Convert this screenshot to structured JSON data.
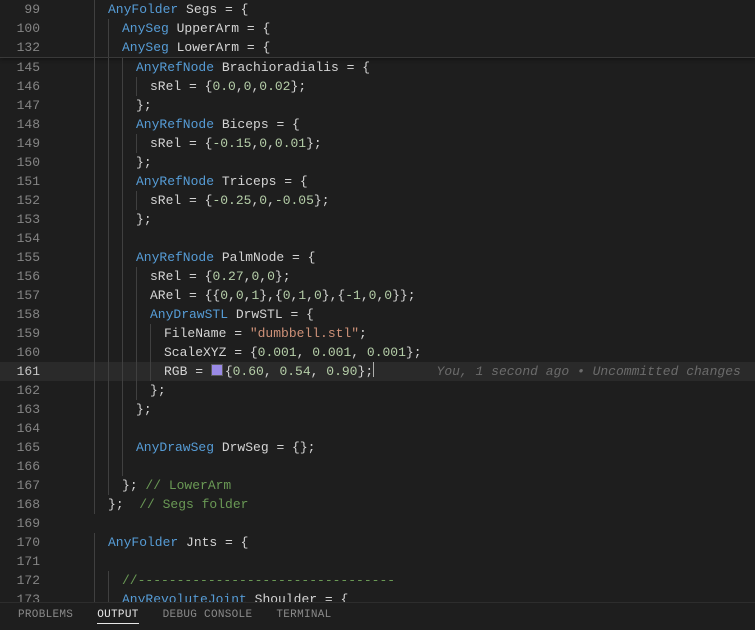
{
  "sticky": [
    {
      "ln": 99,
      "indent": 3,
      "tokens": [
        [
          "kw",
          "AnyFolder"
        ],
        [
          "op",
          " "
        ],
        [
          "id",
          "Segs"
        ],
        [
          "op",
          " = "
        ],
        [
          "brace",
          "{"
        ]
      ]
    },
    {
      "ln": 100,
      "indent": 4,
      "tokens": [
        [
          "kw",
          "AnySeg"
        ],
        [
          "op",
          " "
        ],
        [
          "id",
          "UpperArm"
        ],
        [
          "op",
          " = "
        ],
        [
          "brace",
          "{"
        ]
      ]
    },
    {
      "ln": 132,
      "indent": 4,
      "tokens": [
        [
          "kw",
          "AnySeg"
        ],
        [
          "op",
          " "
        ],
        [
          "id",
          "LowerArm"
        ],
        [
          "op",
          " = "
        ],
        [
          "brace",
          "{"
        ]
      ]
    }
  ],
  "lines": [
    {
      "ln": 145,
      "indent": 5,
      "tokens": [
        [
          "kw",
          "AnyRefNode"
        ],
        [
          "op",
          " "
        ],
        [
          "id",
          "Brachioradialis"
        ],
        [
          "op",
          " = "
        ],
        [
          "brace",
          "{"
        ]
      ]
    },
    {
      "ln": 146,
      "indent": 6,
      "tokens": [
        [
          "id",
          "sRel"
        ],
        [
          "op",
          " = "
        ],
        [
          "brace",
          "{"
        ],
        [
          "num",
          "0.0"
        ],
        [
          "op",
          ","
        ],
        [
          "num",
          "0"
        ],
        [
          "op",
          ","
        ],
        [
          "num",
          "0.02"
        ],
        [
          "brace",
          "}"
        ],
        [
          "op",
          ";"
        ]
      ]
    },
    {
      "ln": 147,
      "indent": 5,
      "tokens": [
        [
          "brace",
          "}"
        ],
        [
          "op",
          ";"
        ]
      ]
    },
    {
      "ln": 148,
      "indent": 5,
      "tokens": [
        [
          "kw",
          "AnyRefNode"
        ],
        [
          "op",
          " "
        ],
        [
          "id",
          "Biceps"
        ],
        [
          "op",
          " = "
        ],
        [
          "brace",
          "{"
        ]
      ]
    },
    {
      "ln": 149,
      "indent": 6,
      "tokens": [
        [
          "id",
          "sRel"
        ],
        [
          "op",
          " = "
        ],
        [
          "brace",
          "{"
        ],
        [
          "num",
          "-0.15"
        ],
        [
          "op",
          ","
        ],
        [
          "num",
          "0"
        ],
        [
          "op",
          ","
        ],
        [
          "num",
          "0.01"
        ],
        [
          "brace",
          "}"
        ],
        [
          "op",
          ";"
        ]
      ]
    },
    {
      "ln": 150,
      "indent": 5,
      "tokens": [
        [
          "brace",
          "}"
        ],
        [
          "op",
          ";"
        ]
      ]
    },
    {
      "ln": 151,
      "indent": 5,
      "tokens": [
        [
          "kw",
          "AnyRefNode"
        ],
        [
          "op",
          " "
        ],
        [
          "id",
          "Triceps"
        ],
        [
          "op",
          " = "
        ],
        [
          "brace",
          "{"
        ]
      ]
    },
    {
      "ln": 152,
      "indent": 6,
      "tokens": [
        [
          "id",
          "sRel"
        ],
        [
          "op",
          " = "
        ],
        [
          "brace",
          "{"
        ],
        [
          "num",
          "-0.25"
        ],
        [
          "op",
          ","
        ],
        [
          "num",
          "0"
        ],
        [
          "op",
          ","
        ],
        [
          "num",
          "-0.05"
        ],
        [
          "brace",
          "}"
        ],
        [
          "op",
          ";"
        ]
      ]
    },
    {
      "ln": 153,
      "indent": 5,
      "tokens": [
        [
          "brace",
          "}"
        ],
        [
          "op",
          ";"
        ]
      ]
    },
    {
      "ln": 154,
      "indent": 5,
      "tokens": []
    },
    {
      "ln": 155,
      "indent": 5,
      "tokens": [
        [
          "kw",
          "AnyRefNode"
        ],
        [
          "op",
          " "
        ],
        [
          "id",
          "PalmNode"
        ],
        [
          "op",
          " = "
        ],
        [
          "brace",
          "{"
        ]
      ]
    },
    {
      "ln": 156,
      "indent": 6,
      "tokens": [
        [
          "id",
          "sRel"
        ],
        [
          "op",
          " = "
        ],
        [
          "brace",
          "{"
        ],
        [
          "num",
          "0.27"
        ],
        [
          "op",
          ","
        ],
        [
          "num",
          "0"
        ],
        [
          "op",
          ","
        ],
        [
          "num",
          "0"
        ],
        [
          "brace",
          "}"
        ],
        [
          "op",
          ";"
        ]
      ]
    },
    {
      "ln": 157,
      "indent": 6,
      "tokens": [
        [
          "id",
          "ARel"
        ],
        [
          "op",
          " = "
        ],
        [
          "brace",
          "{{"
        ],
        [
          "num",
          "0"
        ],
        [
          "op",
          ","
        ],
        [
          "num",
          "0"
        ],
        [
          "op",
          ","
        ],
        [
          "num",
          "1"
        ],
        [
          "brace",
          "}"
        ],
        [
          "op",
          ","
        ],
        [
          "brace",
          "{"
        ],
        [
          "num",
          "0"
        ],
        [
          "op",
          ","
        ],
        [
          "num",
          "1"
        ],
        [
          "op",
          ","
        ],
        [
          "num",
          "0"
        ],
        [
          "brace",
          "}"
        ],
        [
          "op",
          ","
        ],
        [
          "brace",
          "{"
        ],
        [
          "num",
          "-1"
        ],
        [
          "op",
          ","
        ],
        [
          "num",
          "0"
        ],
        [
          "op",
          ","
        ],
        [
          "num",
          "0"
        ],
        [
          "brace",
          "}}"
        ],
        [
          "op",
          ";"
        ]
      ]
    },
    {
      "ln": 158,
      "indent": 6,
      "tokens": [
        [
          "kw",
          "AnyDrawSTL"
        ],
        [
          "op",
          " "
        ],
        [
          "id",
          "DrwSTL"
        ],
        [
          "op",
          " = "
        ],
        [
          "brace",
          "{"
        ]
      ]
    },
    {
      "ln": 159,
      "indent": 7,
      "tokens": [
        [
          "id",
          "FileName"
        ],
        [
          "op",
          " = "
        ],
        [
          "str",
          "\"dumbbell.stl\""
        ],
        [
          "op",
          ";"
        ]
      ]
    },
    {
      "ln": 160,
      "indent": 7,
      "tokens": [
        [
          "id",
          "ScaleXYZ"
        ],
        [
          "op",
          " = "
        ],
        [
          "brace",
          "{"
        ],
        [
          "num",
          "0.001"
        ],
        [
          "op",
          ", "
        ],
        [
          "num",
          "0.001"
        ],
        [
          "op",
          ", "
        ],
        [
          "num",
          "0.001"
        ],
        [
          "brace",
          "}"
        ],
        [
          "op",
          ";"
        ]
      ]
    },
    {
      "ln": 161,
      "indent": 7,
      "active": true,
      "tokens": [
        [
          "id",
          "RGB"
        ],
        [
          "op",
          " = "
        ],
        [
          "swatch",
          "#9a8ae6"
        ],
        [
          "brace",
          "{"
        ],
        [
          "num",
          "0.60"
        ],
        [
          "op",
          ", "
        ],
        [
          "num",
          "0.54"
        ],
        [
          "op",
          ", "
        ],
        [
          "num",
          "0.90"
        ],
        [
          "brace",
          "}"
        ],
        [
          "op",
          ";"
        ],
        [
          "cursor",
          ""
        ],
        [
          "mouse",
          "    "
        ],
        [
          "blame",
          "    You, 1 second ago • Uncommitted changes"
        ]
      ]
    },
    {
      "ln": 162,
      "indent": 6,
      "tokens": [
        [
          "brace",
          "}"
        ],
        [
          "op",
          ";"
        ]
      ]
    },
    {
      "ln": 163,
      "indent": 5,
      "tokens": [
        [
          "brace",
          "}"
        ],
        [
          "op",
          ";"
        ]
      ]
    },
    {
      "ln": 164,
      "indent": 5,
      "tokens": []
    },
    {
      "ln": 165,
      "indent": 5,
      "tokens": [
        [
          "kw",
          "AnyDrawSeg"
        ],
        [
          "op",
          " "
        ],
        [
          "id",
          "DrwSeg"
        ],
        [
          "op",
          " = "
        ],
        [
          "brace",
          "{}"
        ],
        [
          "op",
          ";"
        ]
      ]
    },
    {
      "ln": 166,
      "indent": 5,
      "tokens": []
    },
    {
      "ln": 167,
      "indent": 4,
      "tokens": [
        [
          "brace",
          "}"
        ],
        [
          "op",
          "; "
        ],
        [
          "cmt",
          "// LowerArm"
        ]
      ]
    },
    {
      "ln": 168,
      "indent": 3,
      "tokens": [
        [
          "brace",
          "}"
        ],
        [
          "op",
          ";  "
        ],
        [
          "cmt",
          "// Segs folder"
        ]
      ]
    },
    {
      "ln": 169,
      "indent": 0,
      "tokens": []
    },
    {
      "ln": 170,
      "indent": 3,
      "tokens": [
        [
          "kw",
          "AnyFolder"
        ],
        [
          "op",
          " "
        ],
        [
          "id",
          "Jnts"
        ],
        [
          "op",
          " = "
        ],
        [
          "brace",
          "{"
        ]
      ]
    },
    {
      "ln": 171,
      "indent": 3,
      "tokens": []
    },
    {
      "ln": 172,
      "indent": 4,
      "tokens": [
        [
          "cmt",
          "//---------------------------------"
        ]
      ]
    },
    {
      "ln": 173,
      "indent": 4,
      "tokens": [
        [
          "kw",
          "AnyRevoluteJoint"
        ],
        [
          "op",
          " "
        ],
        [
          "id",
          "Shoulder"
        ],
        [
          "op",
          " = "
        ],
        [
          "brace",
          "{"
        ]
      ]
    }
  ],
  "panel": {
    "tabs": [
      "PROBLEMS",
      "OUTPUT",
      "DEBUG CONSOLE",
      "TERMINAL"
    ],
    "active": "OUTPUT"
  }
}
